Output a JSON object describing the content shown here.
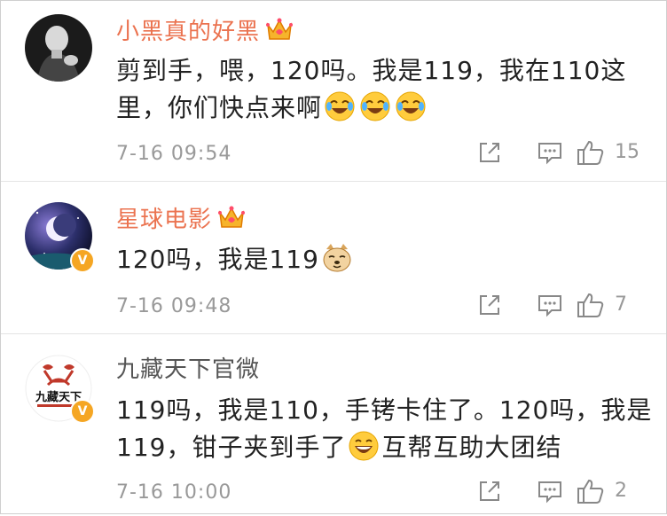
{
  "comments": [
    {
      "username": "小黑真的好黑",
      "text_line1": "剪到手，喂，120吗。我是119，我在110这",
      "text_line2": "里，你们快点来啊",
      "time": "7-16 09:54",
      "like_count": "15"
    },
    {
      "username": "星球电影",
      "text_line1": "120吗，我是119",
      "time": "7-16 09:48",
      "like_count": "7"
    },
    {
      "username": "九藏天下官微",
      "text_line1": "119吗，我是110，手铐卡住了。120吗，我是",
      "text_line2": "119，钳子夹到手了",
      "text_line2_tail": "互帮互助大团结",
      "time": "7-16 10:00",
      "like_count": "2",
      "avatar_logo_text": "九藏天下"
    }
  ],
  "icons": {
    "crown": "vip-crown-icon",
    "verified": "verified-badge-icon",
    "share": "share-icon",
    "reply": "reply-comment-icon",
    "like": "thumbs-up-icon"
  },
  "colors": {
    "vip_name": "#eb7350",
    "normal_name": "#555555",
    "body_text": "#222222",
    "meta_text": "#999999",
    "verified_badge": "#f5a623"
  }
}
